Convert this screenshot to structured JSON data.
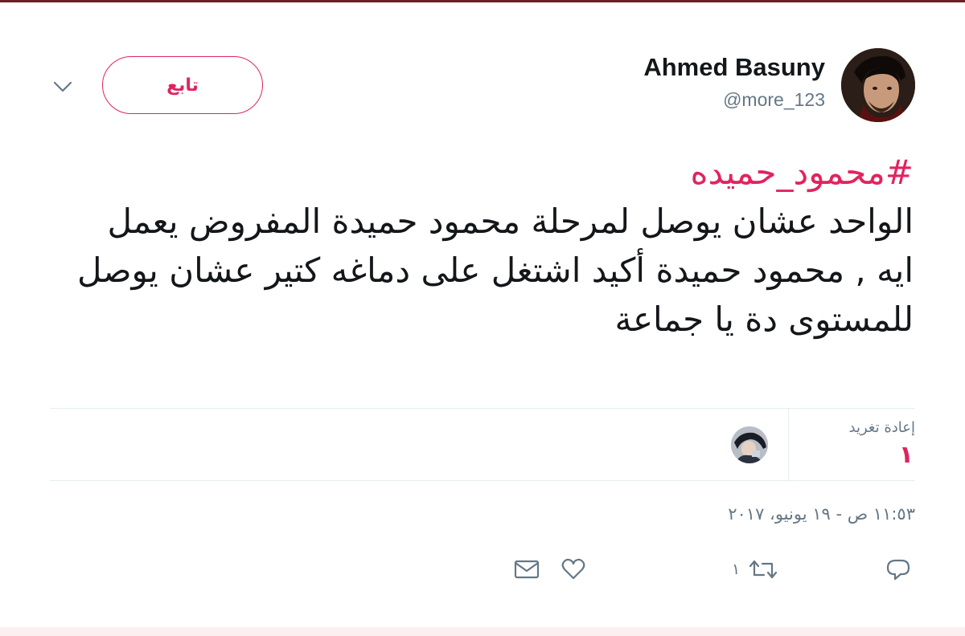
{
  "user": {
    "display_name": "Ahmed Basuny",
    "handle": "@more_123"
  },
  "follow_button": {
    "label": "تابع"
  },
  "tweet": {
    "hashtag": "#محمود_حميده",
    "text": "الواحد عشان يوصل لمرحلة محمود حميدة المفروض يعمل ايه , محمود حميدة أكيد اشتغل على دماغه كتير عشان يوصل للمستوى دة يا جماعة"
  },
  "stats": {
    "retweets_label": "إعادة تغريد",
    "retweets_count": "١"
  },
  "timestamp": "١١:٥٣ ص - ١٩ يونيو، ٢٠١٧",
  "actions": {
    "retweet_count": "١",
    "icons": [
      "reply-icon",
      "retweet-icon",
      "like-icon",
      "message-icon"
    ]
  },
  "colors": {
    "accent": "#e0245e",
    "secondary_text": "#657786",
    "primary_text": "#14171a",
    "divider": "#e6ecf0"
  }
}
